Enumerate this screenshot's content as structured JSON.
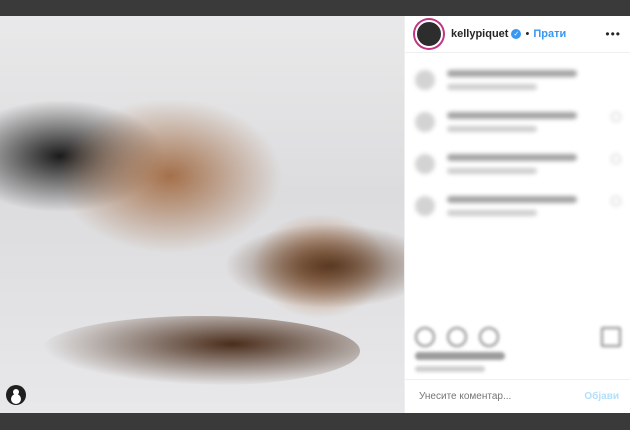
{
  "colors": {
    "accent": "#3897f0",
    "background": "#3a3a3a"
  },
  "header": {
    "username": "kellypiquet",
    "verified_icon": "verified-badge-icon",
    "separator": "•",
    "follow_label": "Прати",
    "more_icon": "more-options-icon"
  },
  "footer": {
    "comment_placeholder": "Унесите коментар...",
    "post_label": "Објави"
  }
}
